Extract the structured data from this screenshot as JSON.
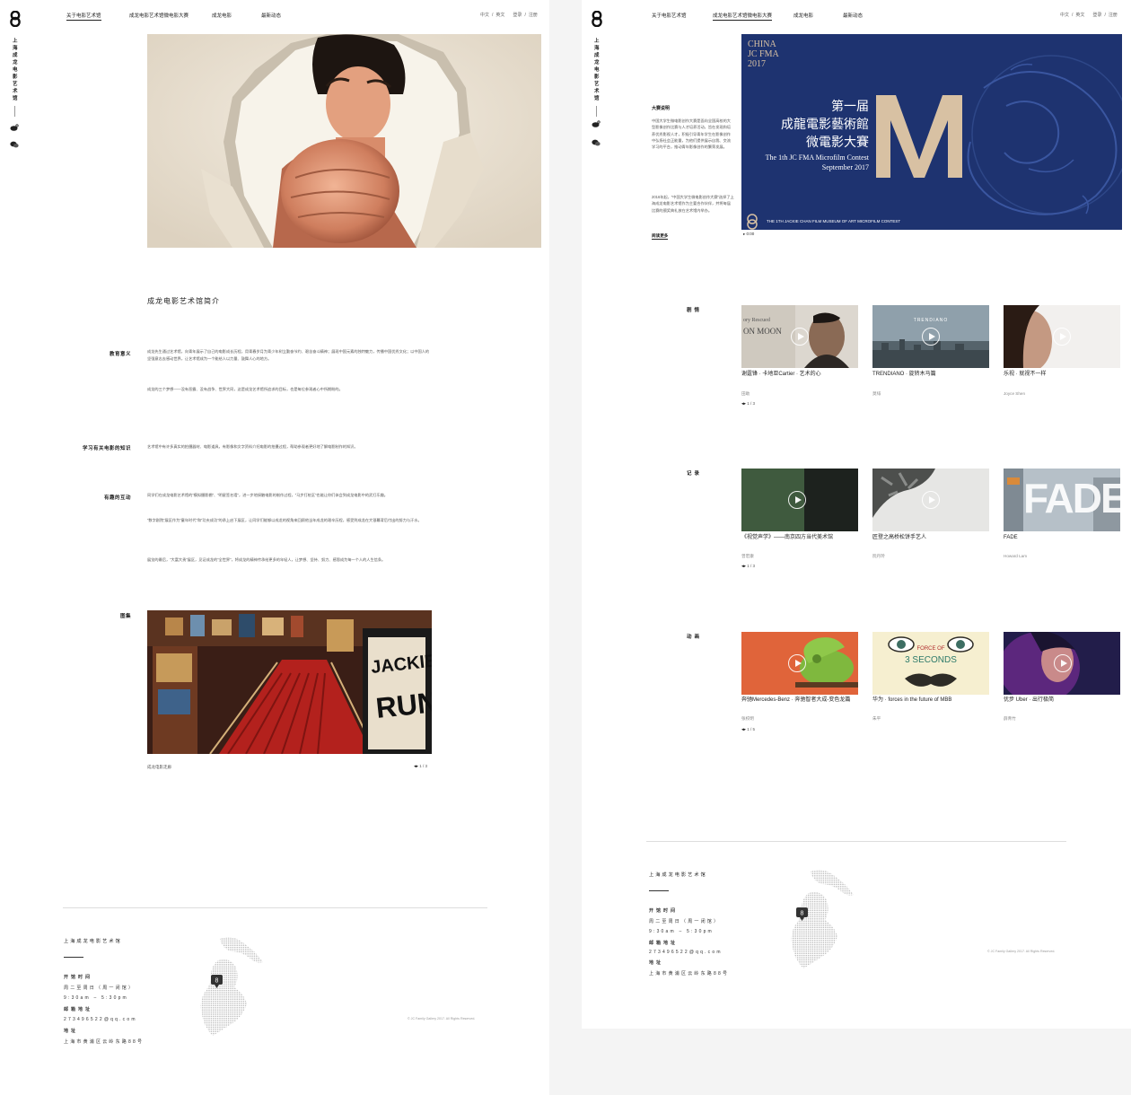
{
  "brand": {
    "vertical_name": "上海成龙电影艺术馆",
    "accent": "#1e3370",
    "gold": "#d8c1a3"
  },
  "nav": {
    "items": [
      "关于电影艺术馆",
      "成龙电影艺术馆微电影大赛",
      "成龙电影",
      "最新动态"
    ]
  },
  "utils": {
    "lang_cn": "中文",
    "sep": "/",
    "lang_en": "英文",
    "login": "登录",
    "register": "注册"
  },
  "left": {
    "section_title": "成龙电影艺术馆简介",
    "blocks": [
      {
        "label": "教育意义",
        "paragraphs": [
          "成龙先生通过艺术馆，向青年展示了自己的电影成长历程，用青春岁月为青少年树立勤奋节约、艰苦奋斗精神；展现中国元素的独特魅力，传播中国优秀文化；以中国人的坚强意志去感动世界，让艺术馆成为一个能给人以力量、鼓舞人心的地方。",
          "成龙的三个梦想——没有恶霸、没有战争、世界大同，这是成龙艺术馆所追求的目标，也是每位参观者心中所期盼的。"
        ]
      },
      {
        "label": "学习有关电影的知识",
        "paragraphs": [
          "艺术馆中有许多真实的拍摄器材、电影道具，有影像和文字资料介绍电影的拍摄过程，帮助参观者更好地了解电影制作的知识。"
        ]
      },
      {
        "label": "有趣的互动",
        "paragraphs": [
          "同学们在成龙电影艺术馆的“模拟摄影棚”、“明星签名墙”，进一步地接触电影的制作过程，“马步打桩区”也能让你们体会到成龙电影中的武打乐趣。",
          "“数字剧院”展区作为“童年时代”和“功夫成功”的承上启下展区，让同学们能够以成龙的视角来回顾他当年成龙的艰辛历程，感受到成龙在大银幕背后付出的努力与汗水。",
          "展览的最后，“大富大贵”展区，见证成龙的“全世界”，将成龙的精神传承给更多的年轻人，让梦想、坚持、努力、感恩成为每一个人的人生信条。"
        ]
      },
      {
        "label": "图集",
        "paragraphs": []
      }
    ],
    "gallery_caption": "成龙电影走廊",
    "gallery_pager": "1 / 3"
  },
  "footer": {
    "museum_name": "上海成龙电影艺术馆",
    "hours_label": "开馆时间",
    "hours_days": "周二至周日（周一闭馆）",
    "hours_time": "9:30am – 5:30pm",
    "email_label": "邮箱地址",
    "email": "273496522@qq.com",
    "address_label": "地址",
    "address": "上海市黄浦区云岭东路88号",
    "copyright": "© JC Family Gallery 2017. All Rights Reserved."
  },
  "right": {
    "poster": {
      "corner_l1": "CHINA",
      "corner_l2": "JC FMA",
      "corner_l3": "2017",
      "title_l1": "第一届",
      "title_l2": "成龍電影藝術館",
      "title_l3": "微電影大賽",
      "en_l1": "The 1th JC FMA Microfilm Contest",
      "en_l2": "September 2017",
      "bottom": "THE 1TH JACKIE CHAN FILM MUSEUM OF ART MICROFILM CONTEST",
      "big_letter": "M",
      "time": "0:00"
    },
    "side": {
      "title": "大赛说明",
      "p1": "中国大学生微电影创作大赛是面向全国高校的大型影像创作比赛与人才培养活动，旨在发现和培养优秀影视人才，积极引导青年学生在影像创作中弘扬社会正能量，为他们提供展示自我、交流学习的平台，推动青年影像创作的繁荣发展。",
      "p2": "2016年起，“中国大学生微电影创作大赛”选择了上海成龙电影艺术馆作为主要合作伙伴，并将每届比赛的颁奖典礼放在艺术馆内举办。",
      "more": "阅读更多"
    },
    "categories": [
      {
        "name": "剧情",
        "pager": "1 / 3",
        "cards": [
          {
            "title": "谢霆锋 · 卡地亚Cartier · 艺术的心",
            "author": "田助"
          },
          {
            "title": "TRENDIANO · 旋转木马篇",
            "author": "莫绯"
          },
          {
            "title": "乐视 · 就视不一样",
            "author": "Joyce Shen"
          }
        ]
      },
      {
        "name": "记录",
        "pager": "1 / 3",
        "cards": [
          {
            "title": "《视觉声学》——南京四方当代美术馆",
            "author": "曾宏康"
          },
          {
            "title": "匠登之高桥松饼手艺人",
            "author": "阮丹玲"
          },
          {
            "title": "FADE",
            "author": "Howard Lam"
          }
        ]
      },
      {
        "name": "动画",
        "pager": "1 / 5",
        "cards": [
          {
            "title": "奔驰Mercedes-Benz · 奔驰智者大成-变色龙篇",
            "author": "张校明"
          },
          {
            "title": "华为 · forces in the future of MBB",
            "author": "朱平"
          },
          {
            "title": "优步 Uber · 出行极简",
            "author": "薛青竹"
          }
        ]
      }
    ],
    "thumb_text": {
      "trend": "TRENDIANO",
      "poster_small_1": "FORCE OF",
      "poster_small_2": "3 SECONDS",
      "fade": "FADE",
      "news1": "ory Rescued",
      "news2": "ON MOON"
    }
  }
}
